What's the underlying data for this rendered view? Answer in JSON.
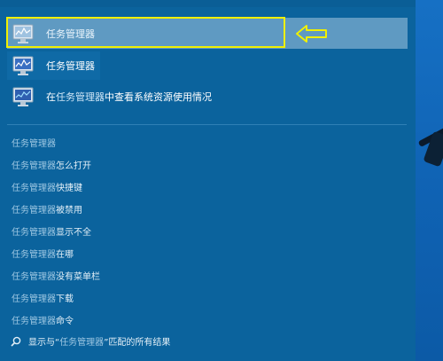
{
  "results": [
    {
      "label": "任务管理器",
      "icon": "task-manager-icon"
    },
    {
      "label": "任务管理器",
      "icon": "task-manager-icon"
    },
    {
      "prefix": "在",
      "highlight": "任务管理器",
      "suffix": "中查看系统资源使用情况",
      "icon": "resource-monitor-icon"
    }
  ],
  "suggestions": [
    {
      "base": "任务管理器",
      "rest": ""
    },
    {
      "base": "任务管理器",
      "rest": "怎么打开"
    },
    {
      "base": "任务管理器",
      "rest": "快捷键"
    },
    {
      "base": "任务管理器",
      "rest": "被禁用"
    },
    {
      "base": "任务管理器",
      "rest": "显示不全"
    },
    {
      "base": "任务管理器",
      "rest": "在哪"
    },
    {
      "base": "任务管理器",
      "rest": "没有菜单栏"
    },
    {
      "base": "任务管理器",
      "rest": "下载"
    },
    {
      "base": "任务管理器",
      "rest": "命令"
    }
  ],
  "search_all": {
    "prefix": "显示与“",
    "highlight": "任务管理器",
    "suffix": "”匹配的所有结果",
    "icon": "search-icon"
  },
  "colors": {
    "panel": "#0b639d",
    "selected": "#5f9ac2",
    "annotation": "#f0f000"
  }
}
